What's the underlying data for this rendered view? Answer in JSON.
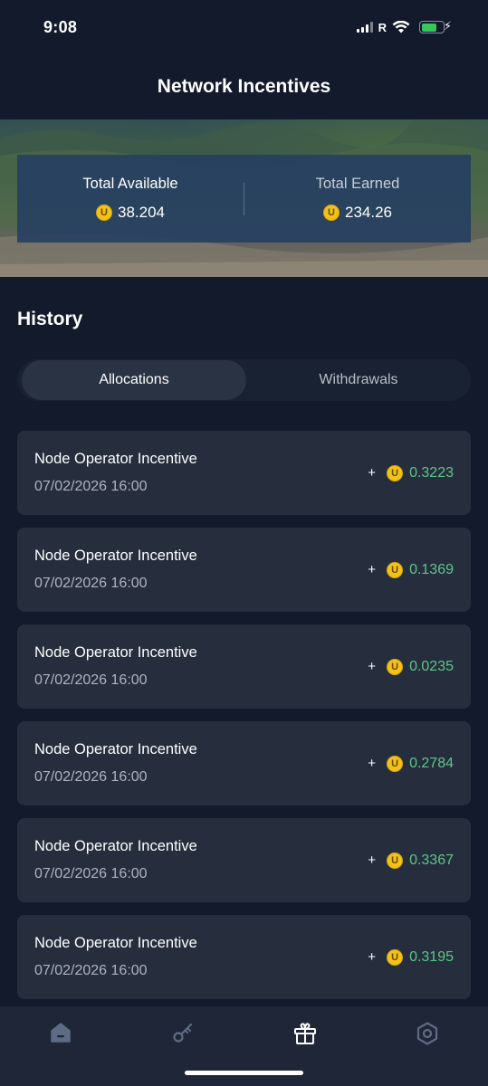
{
  "status_bar": {
    "time": "9:08",
    "carrier": "R"
  },
  "header": {
    "title": "Network Incentives"
  },
  "stats": {
    "available_label": "Total Available",
    "available_value": "38.204",
    "earned_label": "Total Earned",
    "earned_value": "234.26",
    "coin_symbol": "U"
  },
  "history": {
    "title": "History",
    "tabs": [
      {
        "label": "Allocations",
        "active": true
      },
      {
        "label": "Withdrawals",
        "active": false
      }
    ],
    "items": [
      {
        "title": "Node Operator Incentive",
        "date": "07/02/2026 16:00",
        "sign": "+",
        "amount": "0.3223"
      },
      {
        "title": "Node Operator Incentive",
        "date": "07/02/2026 16:00",
        "sign": "+",
        "amount": "0.1369"
      },
      {
        "title": "Node Operator Incentive",
        "date": "07/02/2026 16:00",
        "sign": "+",
        "amount": "0.0235"
      },
      {
        "title": "Node Operator Incentive",
        "date": "07/02/2026 16:00",
        "sign": "+",
        "amount": "0.2784"
      },
      {
        "title": "Node Operator Incentive",
        "date": "07/02/2026 16:00",
        "sign": "+",
        "amount": "0.3367"
      },
      {
        "title": "Node Operator Incentive",
        "date": "07/02/2026 16:00",
        "sign": "+",
        "amount": "0.3195"
      }
    ]
  },
  "nav": {
    "items": [
      {
        "icon": "home-icon",
        "active": false
      },
      {
        "icon": "key-icon",
        "active": false
      },
      {
        "icon": "gift-icon",
        "active": true
      },
      {
        "icon": "settings-hexagon-icon",
        "active": false
      }
    ]
  },
  "colors": {
    "background": "#121a2b",
    "card": "#262e3d",
    "positive_amount": "#5ec48a",
    "coin": "#f2c21a"
  }
}
